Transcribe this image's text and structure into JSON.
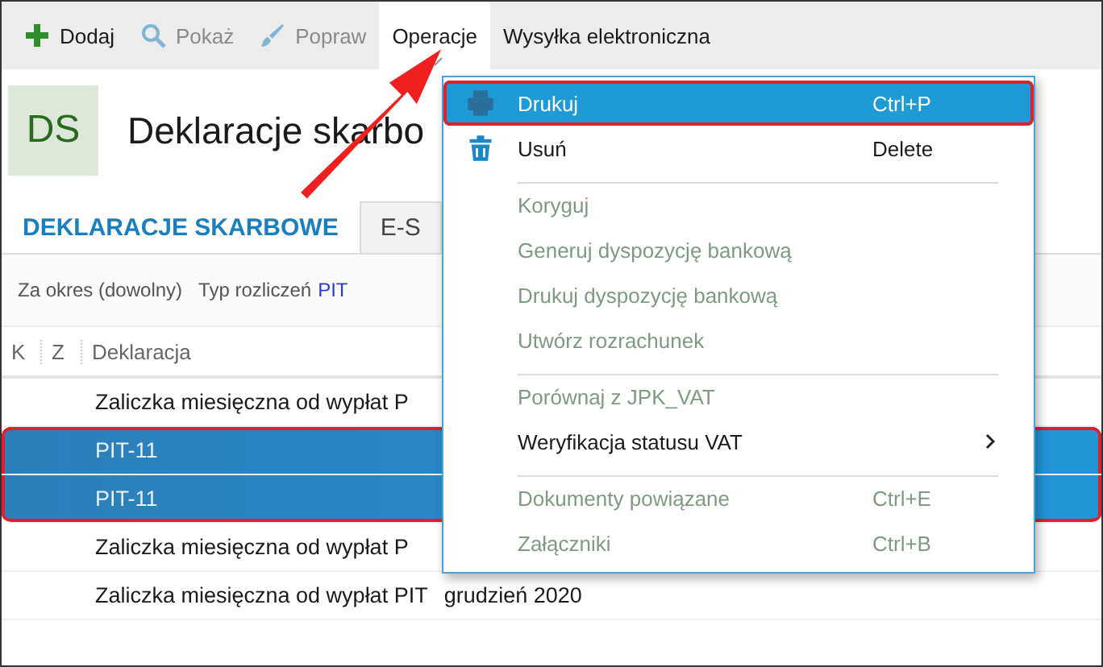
{
  "toolbar": [
    {
      "label": "Dodaj",
      "disabled": false,
      "expanded": false
    },
    {
      "label": "Pokaż",
      "disabled": true,
      "expanded": false
    },
    {
      "label": "Popraw",
      "disabled": true,
      "expanded": false
    },
    {
      "label": "Operacje",
      "disabled": false,
      "expanded": true
    },
    {
      "label": "Wysyłka elektroniczna",
      "disabled": false,
      "expanded": false
    }
  ],
  "header": {
    "badge": "DS",
    "title": "Deklaracje skarbo"
  },
  "tabs": [
    {
      "label": "DEKLARACJE SKARBOWE",
      "selected": true
    },
    {
      "label": "E-S",
      "selected": false
    }
  ],
  "filters": {
    "period": "Za okres (dowolny)",
    "type_label": "Typ rozliczeń",
    "type_value": "PIT"
  },
  "table": {
    "columns": [
      "K",
      "Z",
      "Deklaracja"
    ],
    "rows": [
      {
        "cells": [
          "Zaliczka miesięczna od wypłat P"
        ],
        "selected": false,
        "highlighted": false
      },
      {
        "cells": [
          "PIT-11"
        ],
        "selected": true,
        "highlighted": true
      },
      {
        "cells": [
          "PIT-11"
        ],
        "selected": true,
        "highlighted": true
      },
      {
        "cells": [
          "Zaliczka miesięczna od wypłat P"
        ],
        "selected": false,
        "highlighted": false
      },
      {
        "cells": [
          "Zaliczka miesięczna od wypłat PIT",
          "grudzień 2020"
        ],
        "selected": false,
        "highlighted": false
      }
    ]
  },
  "menu": {
    "items": [
      {
        "label": "Drukuj",
        "shortcut": "Ctrl+P",
        "selected": true,
        "highlighted": true,
        "disabled": false,
        "separator_before": false,
        "kind": "command"
      },
      {
        "label": "Usuń",
        "shortcut": "Delete",
        "selected": false,
        "highlighted": false,
        "disabled": false,
        "separator_before": false,
        "kind": "command"
      },
      {
        "label": "Koryguj",
        "selected": false,
        "highlighted": false,
        "disabled": true,
        "separator_before": true,
        "kind": "command"
      },
      {
        "label": "Generuj dyspozycję bankową",
        "selected": false,
        "highlighted": false,
        "disabled": true,
        "separator_before": false,
        "kind": "command"
      },
      {
        "label": "Drukuj dyspozycję bankową",
        "selected": false,
        "highlighted": false,
        "disabled": true,
        "separator_before": false,
        "kind": "command"
      },
      {
        "label": "Utwórz rozrachunek",
        "selected": false,
        "highlighted": false,
        "disabled": true,
        "separator_before": false,
        "kind": "command"
      },
      {
        "label": "Porównaj z JPK_VAT",
        "selected": false,
        "highlighted": false,
        "disabled": true,
        "separator_before": true,
        "kind": "command"
      },
      {
        "label": "Weryfikacja statusu VAT",
        "selected": false,
        "highlighted": false,
        "disabled": false,
        "separator_before": false,
        "kind": "submenu"
      },
      {
        "label": "Dokumenty powiązane",
        "shortcut": "Ctrl+E",
        "selected": false,
        "highlighted": false,
        "disabled": true,
        "separator_before": true,
        "kind": "command"
      },
      {
        "label": "Załączniki",
        "shortcut": "Ctrl+B",
        "selected": false,
        "highlighted": false,
        "disabled": true,
        "separator_before": false,
        "kind": "command"
      }
    ]
  }
}
